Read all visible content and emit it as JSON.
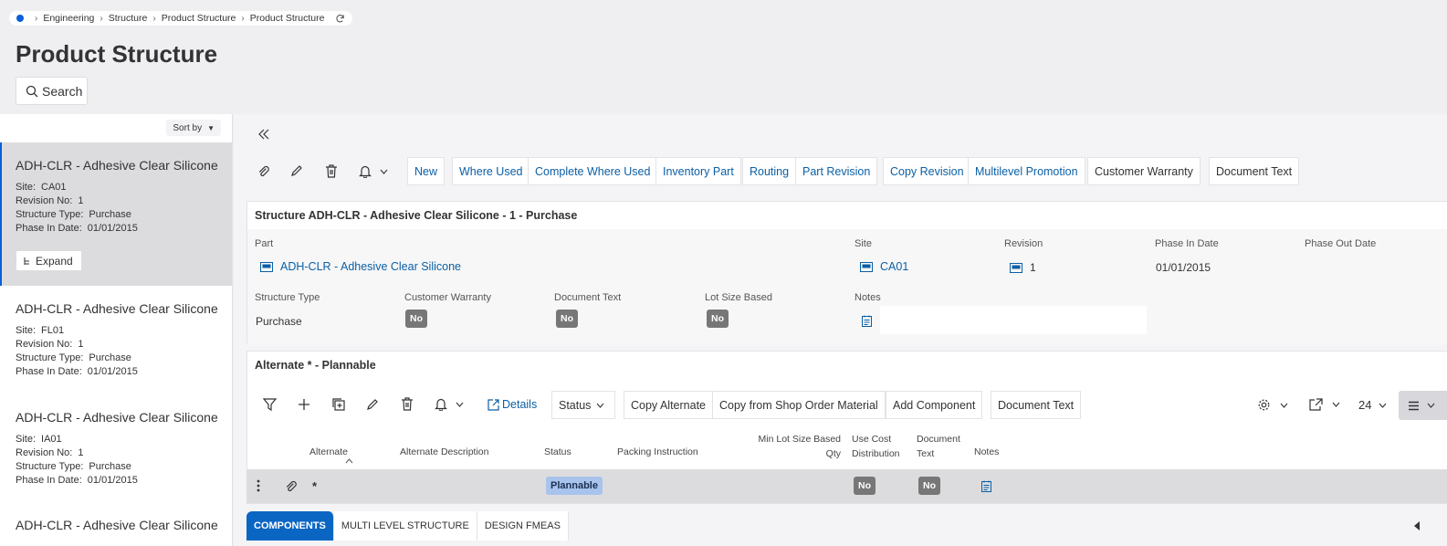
{
  "breadcrumb": {
    "items": [
      "Engineering",
      "Structure",
      "Product Structure",
      "Product Structure"
    ]
  },
  "page": {
    "title": "Product Structure",
    "search_label": "Search"
  },
  "left_list": {
    "sort_label": "Sort by",
    "expand_label": "Expand",
    "cards": [
      {
        "title": "ADH-CLR - Adhesive Clear Silicone",
        "site_label": "Site:",
        "site": "CA01",
        "rev_label": "Revision No:",
        "rev": "1",
        "type_label": "Structure Type:",
        "type": "Purchase",
        "phase_label": "Phase In Date:",
        "phase": "01/01/2015"
      },
      {
        "title": "ADH-CLR - Adhesive Clear Silicone",
        "site_label": "Site:",
        "site": "FL01",
        "rev_label": "Revision No:",
        "rev": "1",
        "type_label": "Structure Type:",
        "type": "Purchase",
        "phase_label": "Phase In Date:",
        "phase": "01/01/2015"
      },
      {
        "title": "ADH-CLR - Adhesive Clear Silicone",
        "site_label": "Site:",
        "site": "IA01",
        "rev_label": "Revision No:",
        "rev": "1",
        "type_label": "Structure Type:",
        "type": "Purchase",
        "phase_label": "Phase In Date:",
        "phase": "01/01/2015"
      },
      {
        "title": "ADH-CLR - Adhesive Clear Silicone"
      }
    ]
  },
  "toolbar": {
    "buttons": [
      "New",
      "Where Used",
      "Complete Where Used",
      "Inventory Part",
      "Routing",
      "Part Revision",
      "Copy Revision",
      "Multilevel Promotion",
      "Customer Warranty",
      "Document Text"
    ]
  },
  "structure": {
    "header": "Structure ADH-CLR - Adhesive Clear Silicone - 1 - Purchase",
    "part_label": "Part",
    "part_value": "ADH-CLR - Adhesive Clear Silicone",
    "site_label": "Site",
    "site_value": "CA01",
    "revision_label": "Revision",
    "revision_value": "1",
    "phase_in_label": "Phase In Date",
    "phase_in_value": "01/01/2015",
    "phase_out_label": "Phase Out Date",
    "type_label": "Structure Type",
    "type_value": "Purchase",
    "warranty_label": "Customer Warranty",
    "warranty_value": "No",
    "doc_text_label": "Document Text",
    "doc_text_value": "No",
    "lot_label": "Lot Size Based",
    "lot_value": "No",
    "notes_label": "Notes"
  },
  "alternate": {
    "header": "Alternate * - Plannable",
    "details_label": "Details",
    "status_label": "Status",
    "buttons": [
      "Copy Alternate",
      "Copy from Shop Order Material",
      "Add Component",
      "Document Text"
    ],
    "page_size": "24",
    "columns": {
      "alternate": "Alternate",
      "description": "Alternate Description",
      "status": "Status",
      "packing": "Packing Instruction",
      "min_lot_1": "Min Lot Size Based",
      "min_lot_2": "Qty",
      "cost_1": "Use Cost",
      "cost_2": "Distribution",
      "doc_1": "Document",
      "doc_2": "Text",
      "notes": "Notes"
    },
    "row": {
      "alternate": "*",
      "status": "Plannable",
      "use_cost": "No",
      "doc_text": "No"
    }
  },
  "tabs": [
    "COMPONENTS",
    "MULTI LEVEL STRUCTURE",
    "DESIGN FMEAS"
  ],
  "colors": {
    "accent": "#0b66c3",
    "link": "#0b5fa5",
    "status_badge": "#a8c3ec",
    "pill": "#777777"
  }
}
